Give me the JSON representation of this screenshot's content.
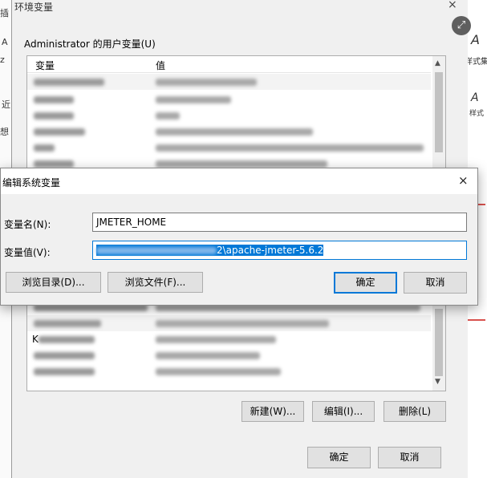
{
  "background_app": {
    "left_fragments": [
      "插",
      "A",
      "z",
      "近",
      "想"
    ],
    "right_fragments": [
      "A",
      "样式集",
      "A",
      "样式"
    ]
  },
  "env_window": {
    "title": "环境变量",
    "close_glyph": "×",
    "user_vars": {
      "group_label": "Administrator 的用户变量(U)",
      "columns": [
        "变量",
        "值"
      ]
    },
    "buttons": {
      "new": "新建(W)...",
      "edit": "编辑(I)...",
      "delete": "删除(L)"
    },
    "footer": {
      "ok": "确定",
      "cancel": "取消"
    }
  },
  "edit_dialog": {
    "title": "编辑系统变量",
    "close_glyph": "×",
    "name_label": "变量名(N):",
    "name_value": "JMETER_HOME",
    "value_label": "变量值(V):",
    "value_visible_suffix": "2\\apache-jmeter-5.6.2",
    "browse_dir": "浏览目录(D)...",
    "browse_file": "浏览文件(F)...",
    "ok": "确定",
    "cancel": "取消"
  },
  "sys_list_visible_prefix": "K",
  "icons": {
    "zoom": "zoom-expand-icon"
  },
  "colors": {
    "accent": "#0078d7",
    "window_bg": "#f0f0f0",
    "field_border": "#7a7a7a"
  }
}
